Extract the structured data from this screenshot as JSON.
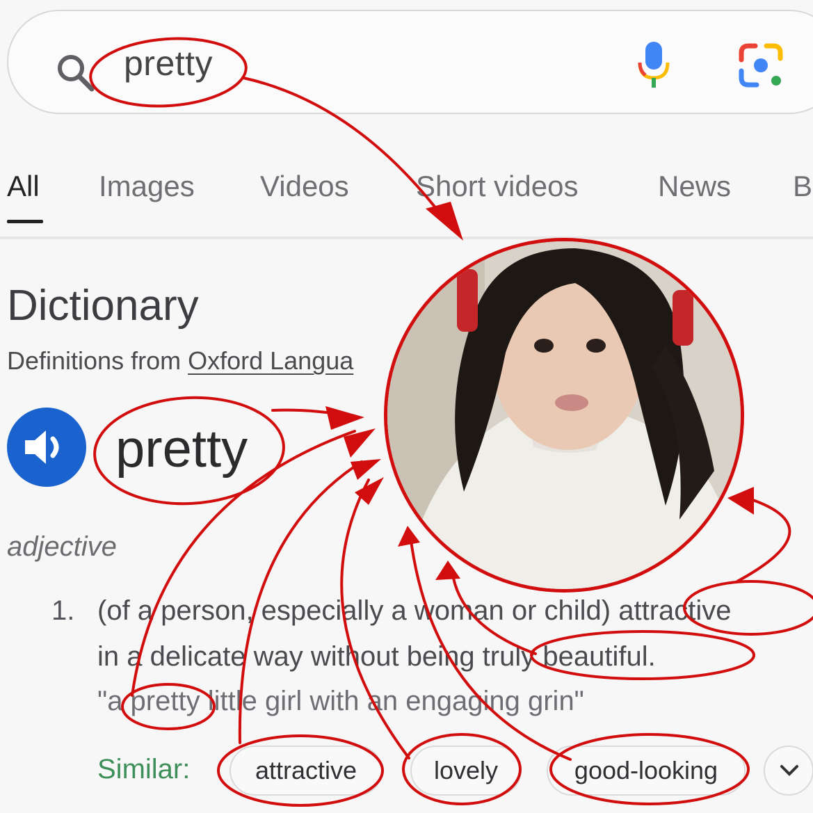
{
  "search": {
    "query": "pretty"
  },
  "tabs": [
    {
      "label": "All",
      "active": true
    },
    {
      "label": "Images"
    },
    {
      "label": "Videos"
    },
    {
      "label": "Short videos"
    },
    {
      "label": "News"
    },
    {
      "label": "B"
    }
  ],
  "dictionary": {
    "title": "Dictionary",
    "source_prefix": "Definitions from ",
    "source_link": "Oxford Langua",
    "word": "pretty",
    "part_of_speech": "adjective",
    "definition_number": "1.",
    "definition_line1": "(of a person, especially a woman or child) attractive",
    "definition_line2": "in a delicate way without being truly beautiful.",
    "example": "\"a pretty little girl with an engaging grin\"",
    "similar_label": "Similar:",
    "similar": [
      "attractive",
      "lovely",
      "good-looking"
    ]
  },
  "colors": {
    "annotation": "#d10d0d",
    "speaker": "#1a63cf",
    "similar_label": "#3f8f5a"
  },
  "icons": [
    "search-icon",
    "microphone-icon",
    "google-lens-icon",
    "speaker-icon",
    "chevron-down-icon"
  ]
}
